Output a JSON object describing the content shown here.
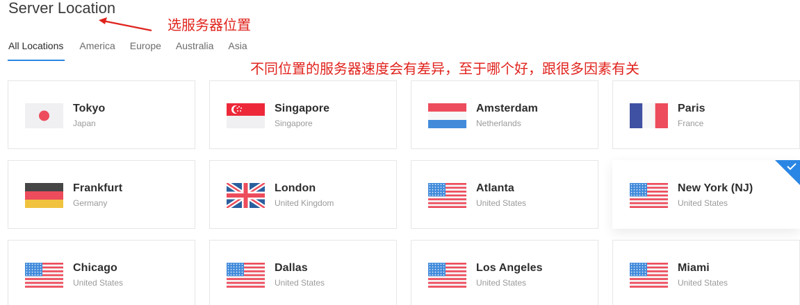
{
  "header": {
    "title": "Server Location"
  },
  "tabs": [
    {
      "label": "All Locations",
      "active": true
    },
    {
      "label": "America"
    },
    {
      "label": "Europe"
    },
    {
      "label": "Australia"
    },
    {
      "label": "Asia"
    }
  ],
  "annotations": {
    "select_server": "选服务器位置",
    "speed_note": "不同位置的服务器速度会有差异，至于哪个好，跟很多因素有关",
    "color": "#e0231d"
  },
  "accent_color": "#2a86e4",
  "locations": [
    {
      "city": "Tokyo",
      "country": "Japan",
      "flag": "japan-flag-icon"
    },
    {
      "city": "Singapore",
      "country": "Singapore",
      "flag": "singapore-flag-icon"
    },
    {
      "city": "Amsterdam",
      "country": "Netherlands",
      "flag": "netherlands-flag-icon"
    },
    {
      "city": "Paris",
      "country": "France",
      "flag": "france-flag-icon"
    },
    {
      "city": "Frankfurt",
      "country": "Germany",
      "flag": "germany-flag-icon"
    },
    {
      "city": "London",
      "country": "United Kingdom",
      "flag": "uk-flag-icon"
    },
    {
      "city": "Atlanta",
      "country": "United States",
      "flag": "us-flag-icon"
    },
    {
      "city": "New York (NJ)",
      "country": "United States",
      "flag": "us-flag-icon",
      "selected": true
    },
    {
      "city": "Chicago",
      "country": "United States",
      "flag": "us-flag-icon"
    },
    {
      "city": "Dallas",
      "country": "United States",
      "flag": "us-flag-icon"
    },
    {
      "city": "Los Angeles",
      "country": "United States",
      "flag": "us-flag-icon"
    },
    {
      "city": "Miami",
      "country": "United States",
      "flag": "us-flag-icon"
    }
  ]
}
